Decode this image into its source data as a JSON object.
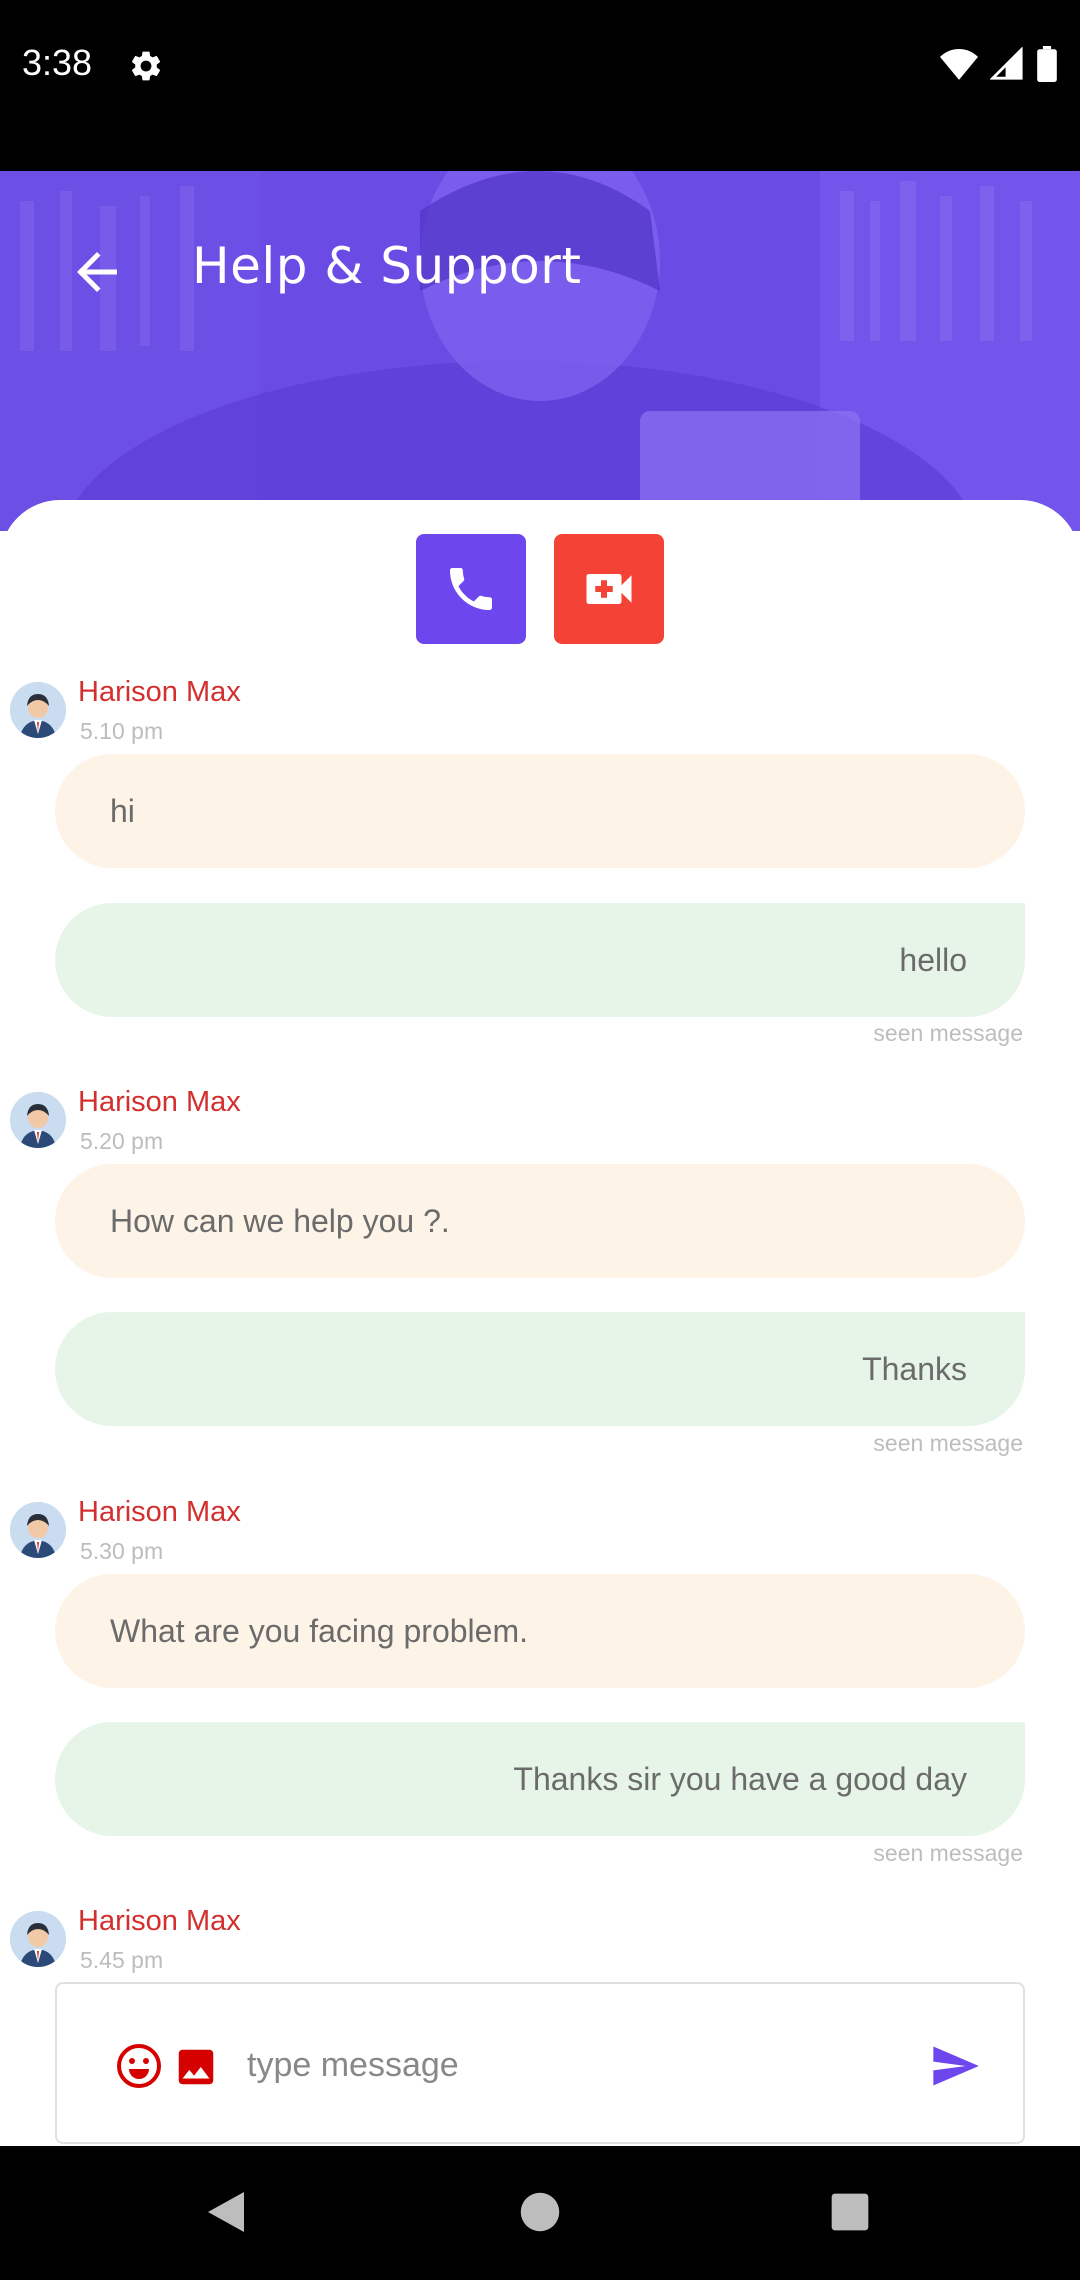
{
  "status_bar": {
    "time": "3:38"
  },
  "header": {
    "title": "Help & Support"
  },
  "actions": {
    "voice_call": "phone-icon",
    "video_call": "video-plus-icon"
  },
  "colors": {
    "accent": "#6d46ee",
    "video": "#f44336",
    "sender": "#d32f2f",
    "incoming_bubble": "#fdf4e7",
    "outgoing_bubble": "#e6f5e7"
  },
  "messages": [
    {
      "sender": "Harison Max",
      "time": "5.10 pm",
      "incoming": "hi",
      "outgoing": "hello",
      "status": "seen message"
    },
    {
      "sender": "Harison Max",
      "time": "5.20 pm",
      "incoming": "How can we help you ?.",
      "outgoing": "Thanks",
      "status": "seen message"
    },
    {
      "sender": "Harison Max",
      "time": "5.30 pm",
      "incoming": "What are you facing problem.",
      "outgoing": "Thanks sir you have a good day",
      "status": "seen message"
    },
    {
      "sender": "Harison Max",
      "time": "5.45 pm"
    }
  ],
  "composer": {
    "placeholder": "type message"
  }
}
